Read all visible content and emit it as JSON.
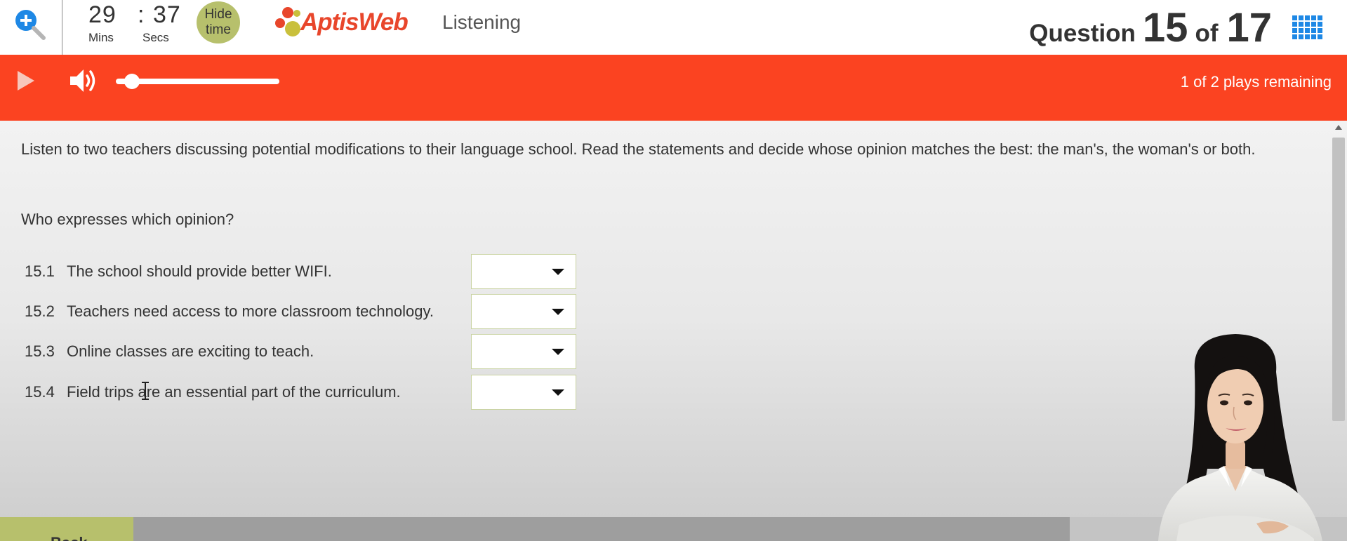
{
  "header": {
    "timer": {
      "minutes": "29",
      "separator": ":",
      "seconds": "37",
      "minutes_label": "Mins",
      "seconds_label": "Secs"
    },
    "hide_time": {
      "line1": "Hide",
      "line2": "time"
    },
    "logo": {
      "text": "AptisWeb"
    },
    "section_title": "Listening",
    "question_counter": {
      "word": "Question",
      "current": "15",
      "of": "of",
      "total": "17"
    }
  },
  "audio": {
    "plays_remaining": "1 of 2 plays remaining",
    "volume_level": 0.1
  },
  "content": {
    "instructions": "Listen to two teachers discussing potential modifications to their language school. Read the statements and decide whose opinion matches the best: the man's, the woman's or both.",
    "prompt": "Who expresses which opinion?",
    "questions": [
      {
        "number": "15.1",
        "text": "The school should provide better WIFI.",
        "selected": ""
      },
      {
        "number": "15.2",
        "text": "Teachers need access to more classroom technology.",
        "selected": ""
      },
      {
        "number": "15.3",
        "text": "Online classes are exciting to teach.",
        "selected": ""
      },
      {
        "number": "15.4",
        "text": "Field trips are an essential part of the curriculum.",
        "selected": ""
      }
    ]
  },
  "footer": {
    "back_label": "Back"
  },
  "colors": {
    "accent_red": "#fb4321",
    "olive": "#b7c06c",
    "grid_blue": "#1e88e5",
    "logo_red": "#e8462b"
  }
}
